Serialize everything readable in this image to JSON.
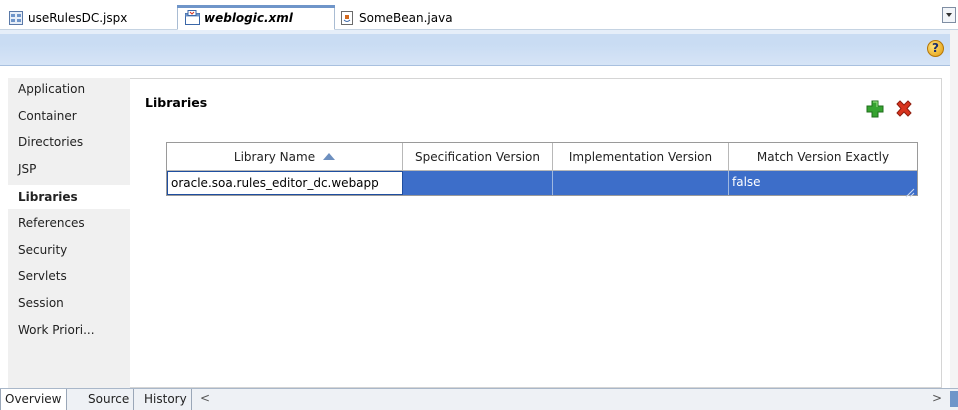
{
  "editor_tabs": [
    {
      "label": "useRulesDC.jspx",
      "icon": "jspx-file-icon",
      "active": false
    },
    {
      "label": "weblogic.xml",
      "icon": "xml-file-icon",
      "active": true
    },
    {
      "label": "SomeBean.java",
      "icon": "java-file-icon",
      "active": false
    }
  ],
  "help": {
    "glyph": "?"
  },
  "nav": {
    "items": [
      {
        "label": "Application"
      },
      {
        "label": "Container"
      },
      {
        "label": "Directories"
      },
      {
        "label": "JSP"
      },
      {
        "label": "Libraries",
        "selected": true
      },
      {
        "label": "References"
      },
      {
        "label": "Security"
      },
      {
        "label": "Servlets"
      },
      {
        "label": "Session"
      },
      {
        "label": "Work Priori..."
      }
    ]
  },
  "section": {
    "title": "Libraries"
  },
  "table": {
    "columns": [
      "Library Name",
      "Specification Version",
      "Implementation Version",
      "Match Version Exactly"
    ],
    "sorted_column": "Library Name",
    "sort_direction": "ascending",
    "rows": [
      {
        "library_name": "oracle.soa.rules_editor_dc.webapp",
        "spec_version": "",
        "impl_version": "",
        "match_exactly": "false"
      }
    ]
  },
  "bottom_tabs": [
    {
      "label": "Overview",
      "active": true
    },
    {
      "label": "Source",
      "active": false
    },
    {
      "label": "History",
      "active": false
    }
  ],
  "scroll": {
    "left_glyph": "<",
    "right_glyph": ">"
  },
  "colors": {
    "selection": "#3d6ec9",
    "header_band": "#c9dcf3",
    "add_green": "#36a330",
    "delete_red": "#d9341e"
  }
}
